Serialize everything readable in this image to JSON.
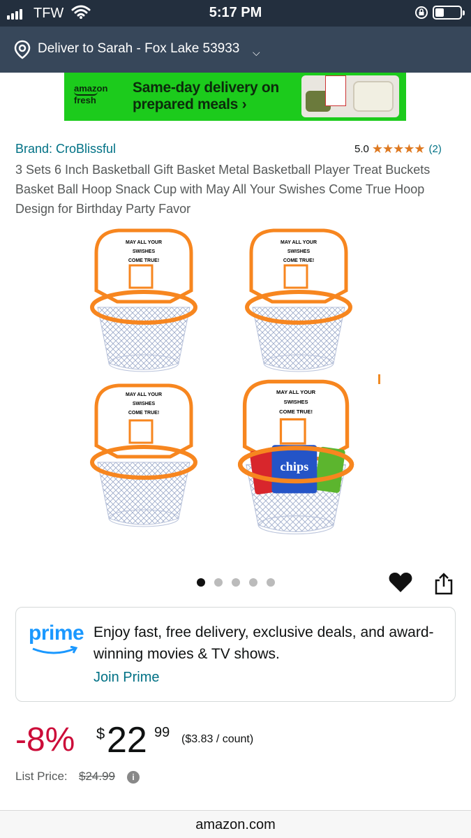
{
  "status_bar": {
    "carrier": "TFW",
    "time": "5:17 PM"
  },
  "deliver": {
    "text": "Deliver to Sarah - Fox Lake 53933",
    "chevron": "⌵"
  },
  "banner": {
    "logo_line1": "amazon",
    "logo_line2": "fresh",
    "headline": "Same-day delivery on prepared meals ›"
  },
  "product": {
    "brand": "Brand: CroBlissful",
    "rating_value": "5.0",
    "stars": "★★★★★",
    "rating_count": "(2)",
    "title": "3 Sets 6 Inch Basketball Gift Basket Metal Basketball Player Treat Buckets Basket Ball Hoop Snack Cup with May All Your Swishes Come True Hoop Design for Birthday Party Favor"
  },
  "image": {
    "backboard_line1": "MAY ALL YOUR",
    "backboard_line2": "SWISHES",
    "backboard_line3": "COME TRUE!",
    "chips_label": "chips",
    "accent_color": "#f7861f"
  },
  "carousel": {
    "total": 5,
    "active": 1
  },
  "prime": {
    "logo": "prime",
    "message": "Enjoy fast, free delivery, exclusive deals, and award-winning movies & TV shows.",
    "join": "Join Prime"
  },
  "price": {
    "discount": "-8%",
    "currency": "$",
    "whole": "22",
    "fraction": "99",
    "per_count": "($3.83 / count)",
    "list_label": "List Price:",
    "list_value": "$24.99"
  },
  "browser": {
    "url": "amazon.com"
  },
  "icons": [
    "location-pin-icon",
    "wifi-icon",
    "rotation-lock-icon",
    "battery-icon",
    "heart-icon",
    "share-icon",
    "info-icon",
    "star-icon"
  ]
}
